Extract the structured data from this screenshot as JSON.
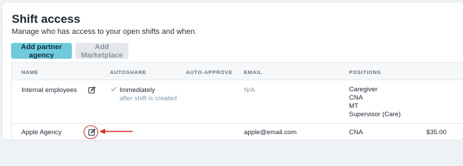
{
  "header": {
    "title": "Shift access",
    "subtitle": "Manage who has access to your open shifts and when."
  },
  "actions": {
    "add_partner_label": "Add partner agency",
    "add_marketplace_label": "Add Marketplace"
  },
  "table": {
    "columns": {
      "name": "NAME",
      "autoshare": "AUTOSHARE",
      "auto_approve": "AUTO-APPROVE",
      "email": "EMAIL",
      "positions": "POSITIONS"
    },
    "rows": [
      {
        "name": "Internal employees",
        "autoshare": "Immediately",
        "autoshare_detail": "after shift is created",
        "auto_approve": "",
        "email": "N/A",
        "positions": [
          "Caregiver",
          "CNA",
          "MT",
          "Supervisor (Care)"
        ]
      },
      {
        "name": "Apple Agency",
        "autoshare": "",
        "auto_approve": "",
        "email": "apple@email.com",
        "positions": [
          "CNA"
        ],
        "rate": "$35.00"
      }
    ]
  },
  "icons": {
    "edit": "edit-icon",
    "check": "check-icon",
    "annotation_arrow": "arrow-icon"
  },
  "colors": {
    "primary_button": "#6fcbdb",
    "secondary_button": "#e4e8ec",
    "annotation": "#e0231b"
  }
}
